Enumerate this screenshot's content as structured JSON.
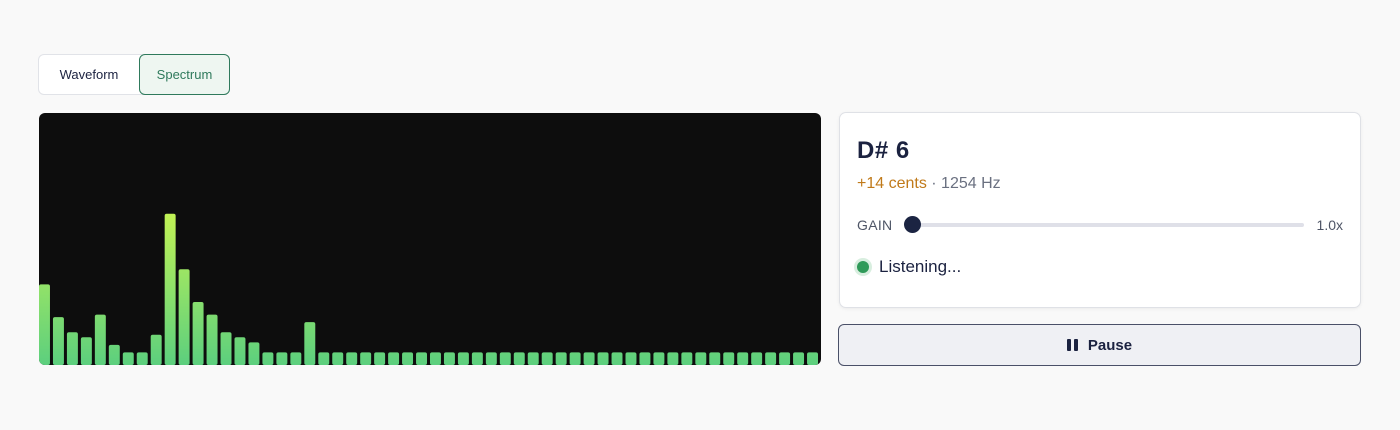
{
  "tabs": [
    {
      "label": "Waveform",
      "active": false
    },
    {
      "label": "Spectrum",
      "active": true
    }
  ],
  "tuner": {
    "note": "D# 6",
    "cents": "+14 cents",
    "separator": " · ",
    "frequency": "1254 Hz",
    "gain_label": "GAIN",
    "gain_value": "1.0x",
    "gain_fraction": 0.0,
    "status": "Listening..."
  },
  "controls": {
    "pause_label": "Pause"
  },
  "colors": {
    "accent": "#2f7a5c",
    "cents": "#c07a1a",
    "status_dot": "#2f9a59",
    "bar_low": "#5ccf7e",
    "bar_high": "#c8f552"
  },
  "chart_data": {
    "type": "bar",
    "values": [
      0.32,
      0.19,
      0.13,
      0.11,
      0.2,
      0.08,
      0.05,
      0.05,
      0.12,
      0.6,
      0.38,
      0.25,
      0.2,
      0.13,
      0.11,
      0.09,
      0.05,
      0.05,
      0.05,
      0.17,
      0.05,
      0.05,
      0.05,
      0.05,
      0.05,
      0.05,
      0.05,
      0.05,
      0.05,
      0.05,
      0.05,
      0.05,
      0.05,
      0.05,
      0.05,
      0.05,
      0.05,
      0.05,
      0.05,
      0.05,
      0.05,
      0.05,
      0.05,
      0.05,
      0.05,
      0.05,
      0.05,
      0.05,
      0.05,
      0.05,
      0.05,
      0.05,
      0.05,
      0.05,
      0.05,
      0.05
    ],
    "ylim": [
      0,
      1
    ]
  }
}
